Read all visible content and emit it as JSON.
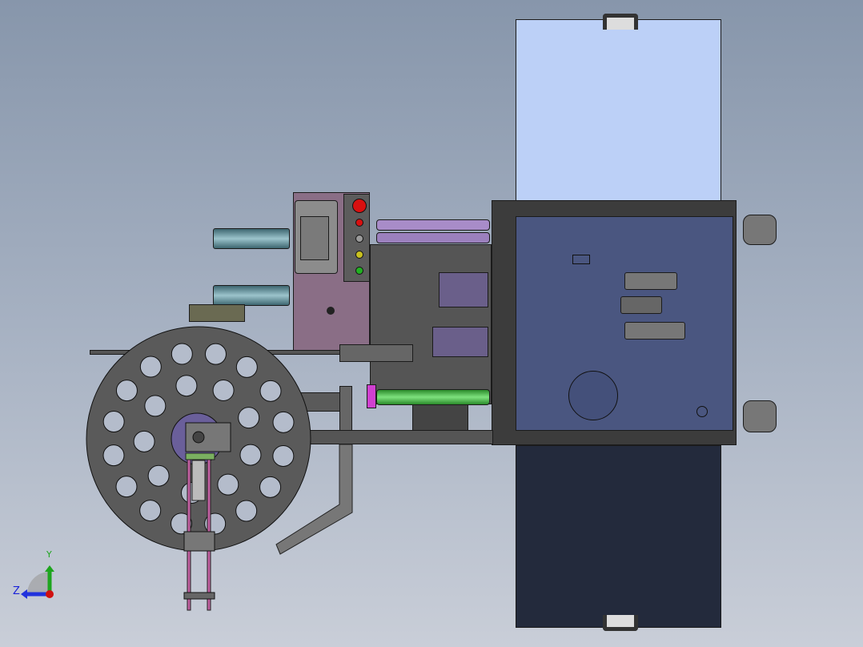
{
  "viewport": {
    "background_top": "#8796ab",
    "background_bottom": "#c9ced8"
  },
  "triad": {
    "y_label": "Y",
    "z_label": "Z",
    "y_color": "#1ea51e",
    "z_color": "#2233dd",
    "origin_color": "#d01010"
  },
  "control_panel": {
    "button_colors": [
      "#d81010",
      "#d81010",
      "#9a9a9a",
      "#c8c020",
      "#22b022"
    ]
  },
  "colors": {
    "door_top": "#bcd0f7",
    "door_bottom": "#232a3c",
    "cabinet": "#4a5680",
    "frame": "#3c3c3c",
    "wheel": "#5a5a5a",
    "hmi": "#8a6e86",
    "green_roller": "#3fbf3f",
    "purple_roller": "#a88cc8"
  }
}
